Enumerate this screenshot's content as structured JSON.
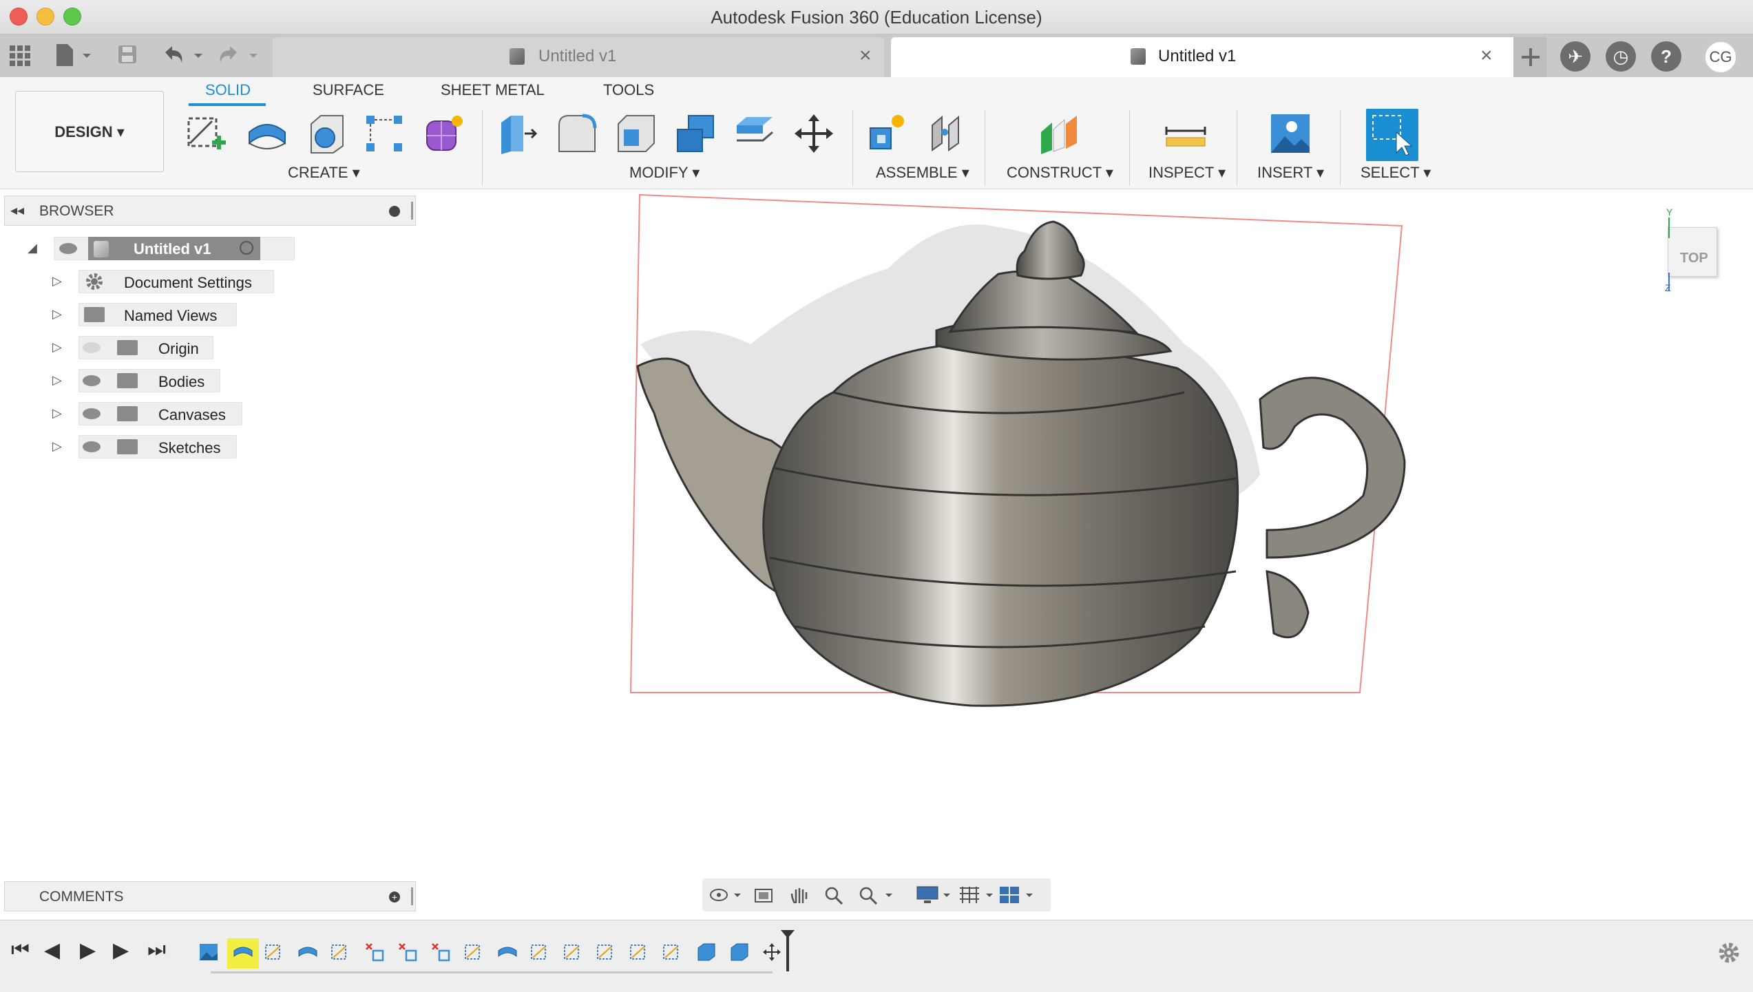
{
  "window": {
    "title": "Autodesk Fusion 360 (Education License)"
  },
  "tabs": [
    {
      "label": "Untitled v1",
      "active": false
    },
    {
      "label": "Untitled v1",
      "active": true
    }
  ],
  "user": {
    "initials": "CG"
  },
  "workspace": {
    "label": "DESIGN ▾"
  },
  "ribbon": {
    "tabs": [
      "SOLID",
      "SURFACE",
      "SHEET METAL",
      "TOOLS"
    ],
    "active_tab": "SOLID",
    "groups": {
      "create": "CREATE ▾",
      "modify": "MODIFY ▾",
      "assemble": "ASSEMBLE ▾",
      "construct": "CONSTRUCT ▾",
      "inspect": "INSPECT ▾",
      "insert": "INSERT ▾",
      "select": "SELECT ▾"
    }
  },
  "browser": {
    "title": "BROWSER",
    "root": "Untitled v1",
    "items": [
      {
        "label": "Document Settings",
        "icon": "gear-icon"
      },
      {
        "label": "Named Views",
        "icon": "folder-icon"
      },
      {
        "label": "Origin",
        "icon": "folder-icon",
        "visible": false
      },
      {
        "label": "Bodies",
        "icon": "folder-icon",
        "visible": true
      },
      {
        "label": "Canvases",
        "icon": "folder-icon",
        "visible": true
      },
      {
        "label": "Sketches",
        "icon": "folder-icon",
        "visible": true
      }
    ]
  },
  "comments": {
    "title": "COMMENTS"
  },
  "viewcube": {
    "face": "TOP",
    "axes": {
      "y": "Y",
      "z": "Z"
    }
  },
  "colors": {
    "accent": "#1a8fd1",
    "select_button": "#1a8fd1",
    "canvas_border": "#f08a8a",
    "timeline_active": "#f2ee44"
  }
}
